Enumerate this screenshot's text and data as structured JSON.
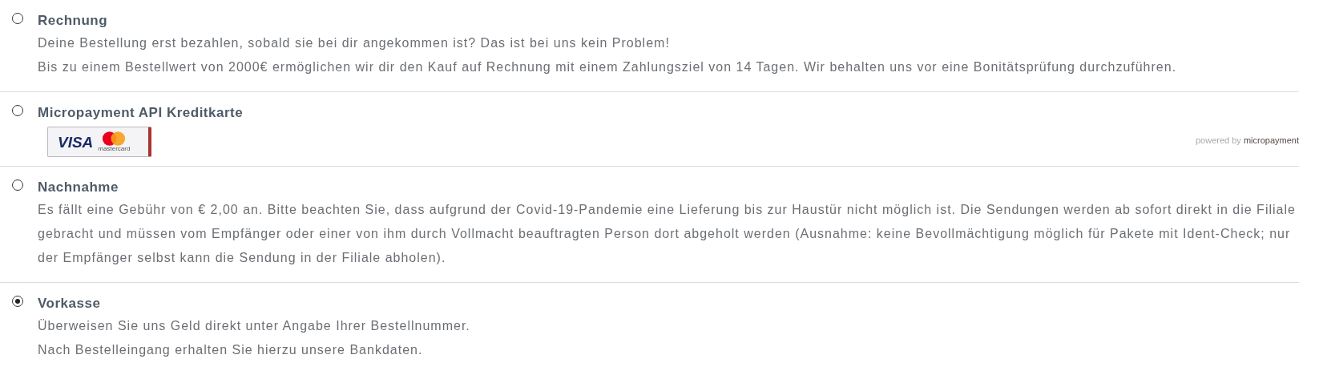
{
  "payment_methods": [
    {
      "kind": "text",
      "title": "Rechnung",
      "selected": false,
      "lines": [
        "Deine Bestellung erst bezahlen, sobald sie bei dir angekommen ist? Das ist bei uns kein Problem!",
        "Bis zu einem Bestellwert von 2000€ ermöglichen wir dir den Kauf auf Rechnung mit einem Zahlungsziel von 14 Tagen. Wir behalten uns vor eine Bonitätsprüfung durchzuführen."
      ]
    },
    {
      "kind": "cards",
      "title": "Micropayment API Kreditkarte",
      "selected": false,
      "card_logo": {
        "visa": "VISA",
        "mastercard": "mastercard"
      },
      "powered_by": {
        "prefix": "powered by",
        "brand": "micropayment"
      }
    },
    {
      "kind": "text",
      "title": "Nachnahme",
      "selected": false,
      "lines": [
        "Es fällt eine Gebühr von € 2,00 an. Bitte beachten Sie, dass aufgrund der Covid-19-Pandemie eine Lieferung bis zur Haustür nicht möglich ist. Die Sendungen werden ab sofort direkt in die Filiale",
        "gebracht und müssen vom Empfänger oder einer von ihm durch Vollmacht beauftragten Person dort abgeholt werden (Ausnahme: keine Bevollmächtigung möglich für Pakete mit Ident-Check; nur",
        "der Empfänger selbst kann die Sendung in der Filiale abholen)."
      ]
    },
    {
      "kind": "text",
      "title": "Vorkasse",
      "selected": true,
      "lines": [
        "Überweisen Sie uns Geld direkt unter Angabe Ihrer Bestellnummer.",
        "Nach Bestelleingang erhalten Sie hierzu unsere Bankdaten."
      ]
    }
  ]
}
